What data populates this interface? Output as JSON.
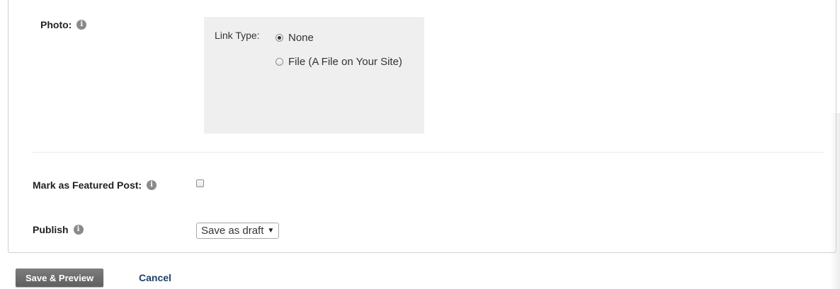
{
  "photo": {
    "label": "Photo:",
    "info_icon": "info-icon",
    "link_type_label": "Link Type:",
    "options": [
      {
        "label": "None",
        "checked": true
      },
      {
        "label": "File (A File on Your Site)",
        "checked": false
      }
    ]
  },
  "featured": {
    "label": "Mark as Featured Post:",
    "info_icon": "info-icon",
    "checked": false
  },
  "publish": {
    "label": "Publish",
    "info_icon": "info-icon",
    "selected": "Save as draft"
  },
  "actions": {
    "save_label": "Save & Preview",
    "cancel_label": "Cancel"
  },
  "colors": {
    "panel_bg": "#efefef",
    "button_bg": "#6b6b6b",
    "link": "#1f3f66"
  }
}
